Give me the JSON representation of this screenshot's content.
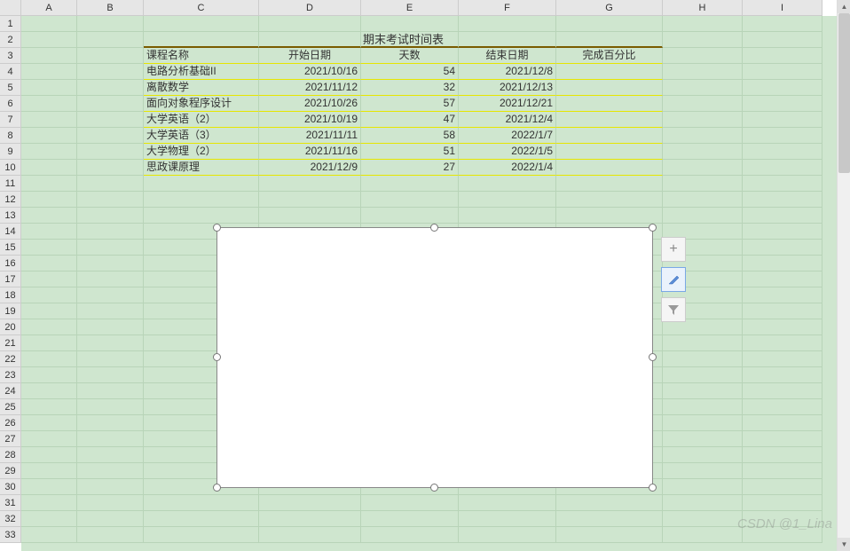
{
  "columns": [
    "A",
    "B",
    "C",
    "D",
    "E",
    "F",
    "G",
    "H",
    "I"
  ],
  "title": "期末考试时间表",
  "headers": {
    "course": "课程名称",
    "start": "开始日期",
    "days": "天数",
    "end": "结束日期",
    "pct": "完成百分比"
  },
  "rows": [
    {
      "course": "电路分析基础II",
      "start": "2021/10/16",
      "days": "54",
      "end": "2021/12/8",
      "pct": ""
    },
    {
      "course": "离散数学",
      "start": "2021/11/12",
      "days": "32",
      "end": "2021/12/13",
      "pct": ""
    },
    {
      "course": "面向对象程序设计",
      "start": "2021/10/26",
      "days": "57",
      "end": "2021/12/21",
      "pct": ""
    },
    {
      "course": "大学英语（2）",
      "start": "2021/10/19",
      "days": "47",
      "end": "2021/12/4",
      "pct": ""
    },
    {
      "course": "大学英语（3）",
      "start": "2021/11/11",
      "days": "58",
      "end": "2022/1/7",
      "pct": ""
    },
    {
      "course": "大学物理（2）",
      "start": "2021/11/16",
      "days": "51",
      "end": "2022/1/5",
      "pct": ""
    },
    {
      "course": "思政课原理",
      "start": "2021/12/9",
      "days": "27",
      "end": "2022/1/4",
      "pct": ""
    }
  ],
  "side_buttons": {
    "plus": "+",
    "brush": "✎",
    "filter": "▾"
  },
  "watermark": "CSDN @1_Lina",
  "scroll": {
    "up": "▲",
    "down": "▼"
  }
}
